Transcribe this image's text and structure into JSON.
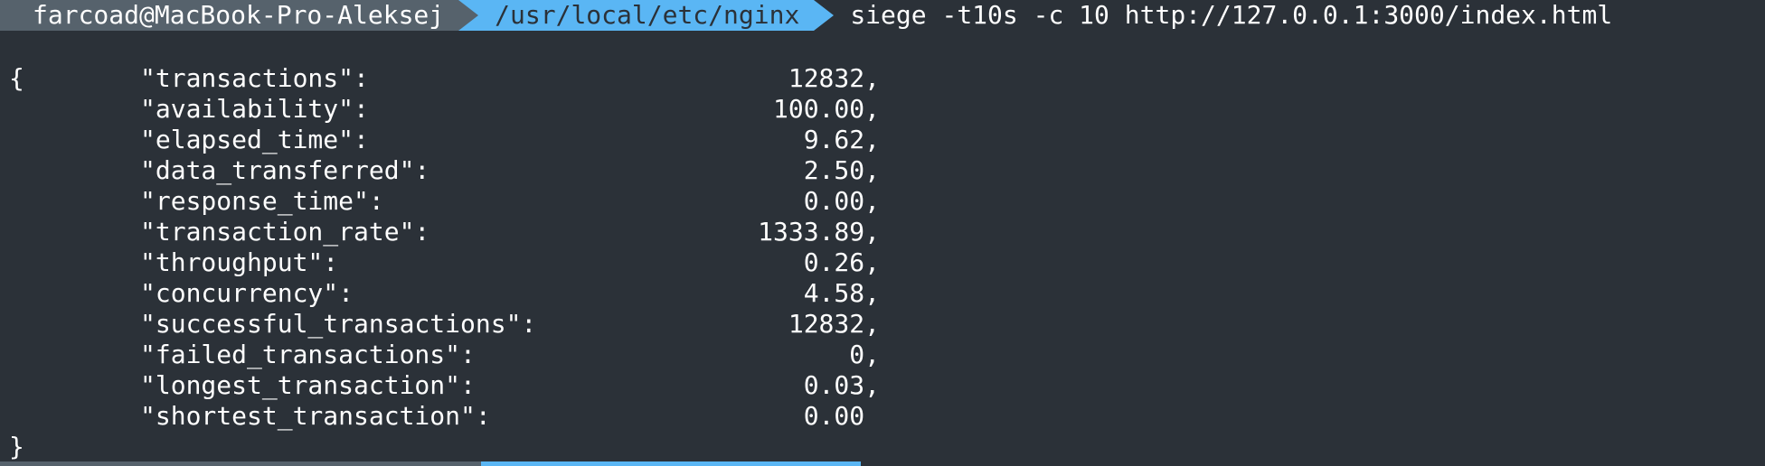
{
  "prompt": {
    "user_host": "farcoad@MacBook-Pro-Aleksej",
    "path": "/usr/local/etc/nginx",
    "command": "siege -t10s -c 10 http://127.0.0.1:3000/index.html"
  },
  "output": {
    "open_brace": "{",
    "close_brace": "}",
    "rows": [
      {
        "key": "\"transactions\":",
        "value": "12832,"
      },
      {
        "key": "\"availability\":",
        "value": "100.00,"
      },
      {
        "key": "\"elapsed_time\":",
        "value": "9.62,"
      },
      {
        "key": "\"data_transferred\":",
        "value": "2.50,"
      },
      {
        "key": "\"response_time\":",
        "value": "0.00,"
      },
      {
        "key": "\"transaction_rate\":",
        "value": "1333.89,"
      },
      {
        "key": "\"throughput\":",
        "value": "0.26,"
      },
      {
        "key": "\"concurrency\":",
        "value": "4.58,"
      },
      {
        "key": "\"successful_transactions\":",
        "value": "12832,"
      },
      {
        "key": "\"failed_transactions\":",
        "value": "0,"
      },
      {
        "key": "\"longest_transaction\":",
        "value": "0.03,"
      },
      {
        "key": "\"shortest_transaction\":",
        "value": "0.00 "
      }
    ]
  },
  "colors": {
    "background": "#2b3138",
    "user_segment": "#56626c",
    "path_segment": "#5ab6f4",
    "text": "#ffffff"
  }
}
